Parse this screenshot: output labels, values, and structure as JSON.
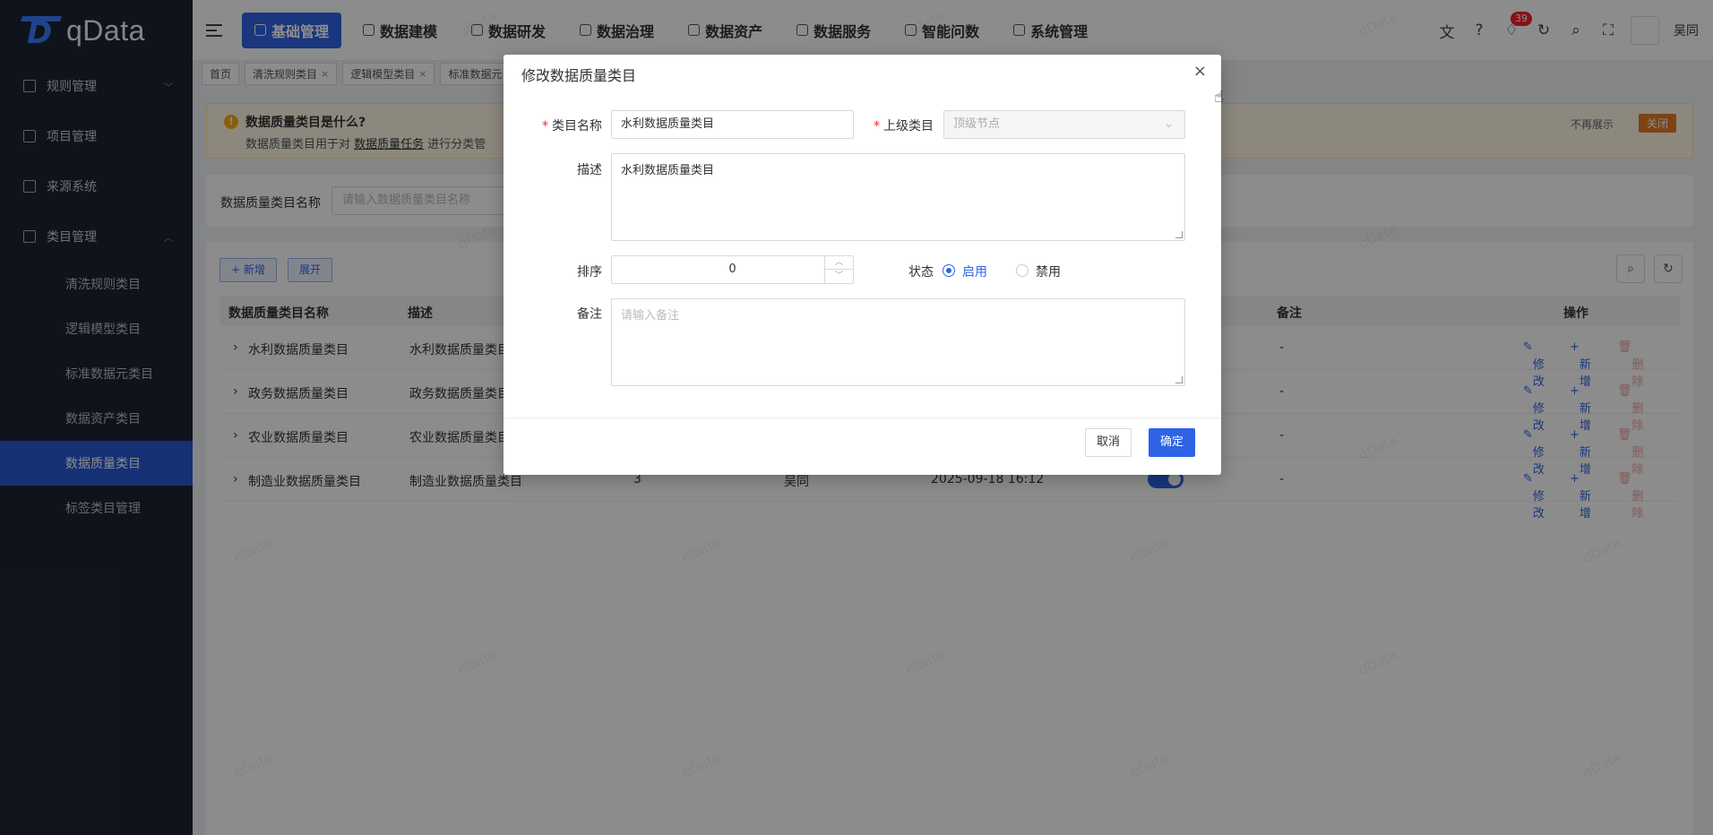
{
  "app": {
    "logo_text": "qData"
  },
  "sidebar": {
    "items": [
      {
        "label": "规则管理",
        "arrow": "﹀"
      },
      {
        "label": "项目管理"
      },
      {
        "label": "来源系统"
      },
      {
        "label": "类目管理",
        "arrow": "︿"
      }
    ],
    "sub_items": [
      {
        "label": "清洗规则类目"
      },
      {
        "label": "逻辑模型类目"
      },
      {
        "label": "标准数据元类目"
      },
      {
        "label": "数据资产类目"
      },
      {
        "label": "数据质量类目"
      },
      {
        "label": "标签类目管理"
      }
    ]
  },
  "topnav": {
    "items": [
      {
        "label": "基础管理"
      },
      {
        "label": "数据建模"
      },
      {
        "label": "数据研发"
      },
      {
        "label": "数据治理"
      },
      {
        "label": "数据资产"
      },
      {
        "label": "数据服务"
      },
      {
        "label": "智能问数"
      },
      {
        "label": "系统管理"
      }
    ],
    "notification_count": "39",
    "username": "吴同"
  },
  "tabs": [
    {
      "label": "首页"
    },
    {
      "label": "清洗规则类目"
    },
    {
      "label": "逻辑模型类目"
    },
    {
      "label": "标准数据元"
    }
  ],
  "notice": {
    "title": "数据质量类目是什么?",
    "desc_prefix": "数据质量类目用于对 ",
    "desc_link": "数据质量任务",
    "desc_suffix": " 进行分类管",
    "no_more": "不再展示",
    "close": "关闭"
  },
  "search": {
    "label": "数据质量类目名称",
    "placeholder": "请输入数据质量类目名称"
  },
  "table": {
    "add_btn": "+ 新增",
    "expand_btn": "展开",
    "headers": {
      "name": "数据质量类目名称",
      "desc": "描述",
      "remark": "备注",
      "ops": "操作"
    },
    "rows": [
      {
        "name": "水利数据质量类目",
        "desc": "水利数据质量类目",
        "remark": "-"
      },
      {
        "name": "政务数据质量类目",
        "desc": "政务数据质量类目",
        "remark": "-"
      },
      {
        "name": "农业数据质量类目",
        "desc": "农业数据质量类目",
        "remark": "-"
      },
      {
        "name": "制造业数据质量类目",
        "desc": "制造业数据质量类目",
        "order": "3",
        "creator": "吴同",
        "time": "2025-09-18 16:12",
        "remark": "-"
      }
    ],
    "op_edit": "修改",
    "op_add": "新增",
    "op_delete": "删除"
  },
  "watermark": "qData",
  "modal": {
    "title": "修改数据质量类目",
    "name_label": "类目名称",
    "name_value": "水利数据质量类目",
    "parent_label": "上级类目",
    "parent_value": "顶级节点",
    "desc_label": "描述",
    "desc_value": "水利数据质量类目",
    "order_label": "排序",
    "order_value": "0",
    "status_label": "状态",
    "status_on": "启用",
    "status_off": "禁用",
    "remark_label": "备注",
    "remark_placeholder": "请输入备注",
    "cancel": "取消",
    "confirm": "确定"
  }
}
